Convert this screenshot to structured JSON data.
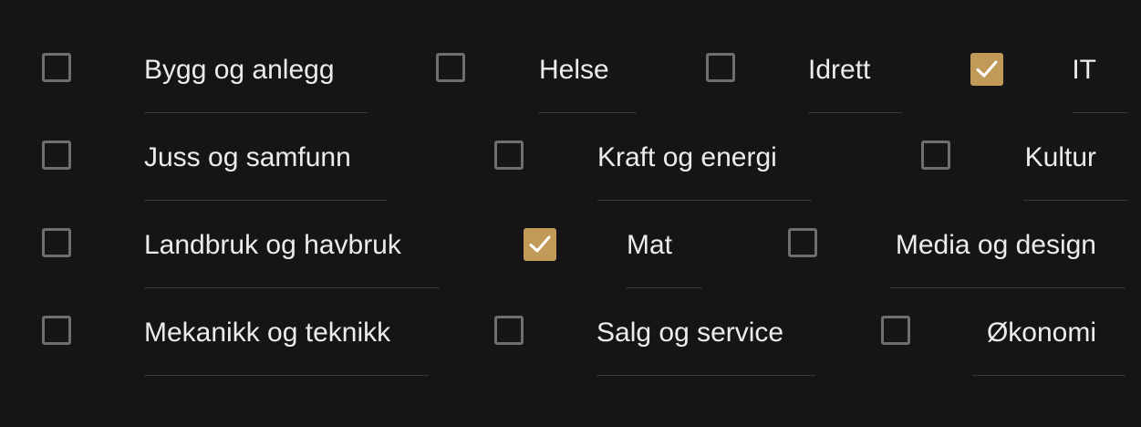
{
  "theme": {
    "background": "#151515",
    "text": "#ececec",
    "checkbox_border": "#6f6f6f",
    "checked_fill": "#c19a59",
    "checkmark": "#ffffff",
    "underline": "#3a3a3a"
  },
  "categories": [
    {
      "label": "Bygg og anlegg",
      "checked": false
    },
    {
      "label": "Helse",
      "checked": false
    },
    {
      "label": "Idrett",
      "checked": false
    },
    {
      "label": "IT",
      "checked": true
    },
    {
      "label": "Juss og samfunn",
      "checked": false
    },
    {
      "label": "Kraft og energi",
      "checked": false
    },
    {
      "label": "Kultur",
      "checked": false
    },
    {
      "label": "Landbruk og havbruk",
      "checked": false
    },
    {
      "label": "Mat",
      "checked": true
    },
    {
      "label": "Media og design",
      "checked": false
    },
    {
      "label": "Mekanikk og teknikk",
      "checked": false
    },
    {
      "label": "Salg og service",
      "checked": false
    },
    {
      "label": "Økonomi",
      "checked": false
    }
  ]
}
